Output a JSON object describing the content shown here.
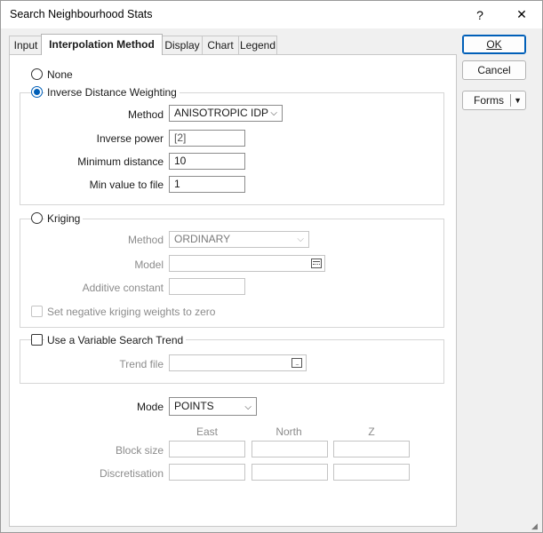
{
  "window": {
    "title": "Search Neighbourhood Stats",
    "help_label": "?",
    "close_label": "✕"
  },
  "tabs": [
    {
      "label": "Input",
      "active": false
    },
    {
      "label": "Interpolation Method",
      "active": true
    },
    {
      "label": "Display",
      "active": false
    },
    {
      "label": "Chart",
      "active": false
    },
    {
      "label": "Legend",
      "active": false
    }
  ],
  "buttons": {
    "ok": "OK",
    "cancel": "Cancel",
    "forms": "Forms"
  },
  "none": {
    "label": "None",
    "checked": false
  },
  "idw": {
    "label": "Inverse Distance Weighting",
    "checked": true,
    "method_label": "Method",
    "method_value": "ANISOTROPIC IDP",
    "power_label": "Inverse power",
    "power_value": "[2]",
    "min_distance_label": "Minimum distance",
    "min_distance_value": "10",
    "min_value_label": "Min value to file",
    "min_value_value": "1"
  },
  "kriging": {
    "label": "Kriging",
    "checked": false,
    "method_label": "Method",
    "method_value": "ORDINARY",
    "model_label": "Model",
    "model_value": "",
    "additive_label": "Additive constant",
    "additive_value": "",
    "negative_label": "Set negative kriging weights to zero"
  },
  "trend": {
    "label": "Use a Variable Search Trend",
    "checked": false,
    "file_label": "Trend file",
    "file_value": ""
  },
  "mode": {
    "label": "Mode",
    "value": "POINTS",
    "columns": [
      "East",
      "North",
      "Z"
    ],
    "block_size_label": "Block size",
    "discretisation_label": "Discretisation"
  },
  "icons": {
    "help": "question-mark",
    "close": "close-x",
    "dropdown": "chevron-down",
    "picker": "list-picker",
    "browse": "ellipsis-browse",
    "resize": "resize-grip"
  }
}
